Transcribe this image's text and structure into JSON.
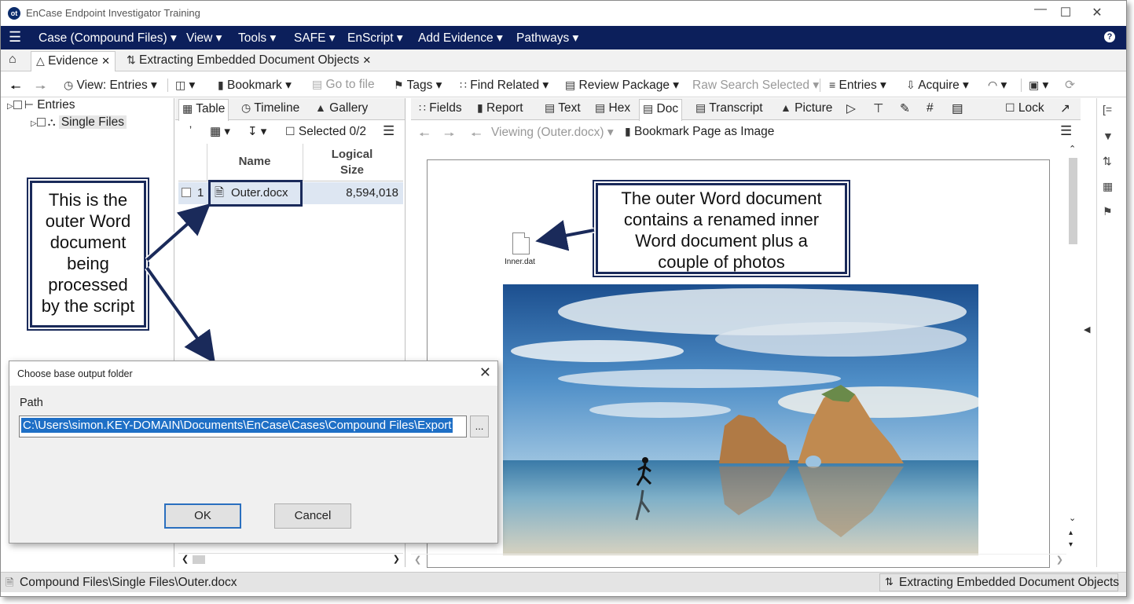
{
  "app": {
    "title": "EnCase Endpoint Investigator Training",
    "logo": "ot"
  },
  "menubar": {
    "items": [
      "Case (Compound Files)",
      "View",
      "Tools",
      "SAFE",
      "EnScript",
      "Add Evidence",
      "Pathways"
    ]
  },
  "tabs": {
    "evidence": "Evidence",
    "script": "Extracting Embedded Document Objects"
  },
  "toolbar": {
    "view": "View: Entries",
    "bookmark": "Bookmark",
    "goto": "Go to file",
    "tags": "Tags",
    "find_related": "Find Related",
    "review": "Review Package",
    "raw_search": "Raw Search Selected",
    "entries": "Entries",
    "acquire": "Acquire"
  },
  "tree": {
    "root": "Entries",
    "child": "Single Files"
  },
  "table_pane": {
    "tabs": [
      "Table",
      "Timeline",
      "Gallery"
    ],
    "selected": "Selected 0/2",
    "col_name": "Name",
    "col_size_line1": "Logical",
    "col_size_line2": "Size",
    "row": {
      "index": "1",
      "name": "Outer.docx",
      "size": "8,594,018"
    }
  },
  "doc_pane": {
    "tabs": [
      "Fields",
      "Report",
      "Text",
      "Hex",
      "Doc",
      "Transcript",
      "Picture"
    ],
    "lock": "Lock",
    "viewing": "Viewing (Outer.docx)",
    "bookmark_page": "Bookmark Page as Image",
    "embedded_file": "Inner.dat"
  },
  "callouts": {
    "left": [
      "This is the",
      "outer Word",
      "document",
      "being",
      "processed",
      "by the script"
    ],
    "right": [
      "The outer Word document",
      "contains a renamed inner",
      "Word document plus a",
      "couple of photos"
    ]
  },
  "dialog": {
    "title": "Choose base output folder",
    "path_label": "Path",
    "path_value": "C:\\Users\\simon.KEY-DOMAIN\\Documents\\EnCase\\Cases\\Compound Files\\Export",
    "browse": "...",
    "ok": "OK",
    "cancel": "Cancel"
  },
  "status": {
    "path": "Compound Files\\Single Files\\Outer.docx",
    "task": "Extracting Embedded Document Objects"
  },
  "colors": {
    "menubar": "#0c1f5b",
    "callout_border": "#1a2a5a",
    "selection": "#1e6fc6"
  }
}
